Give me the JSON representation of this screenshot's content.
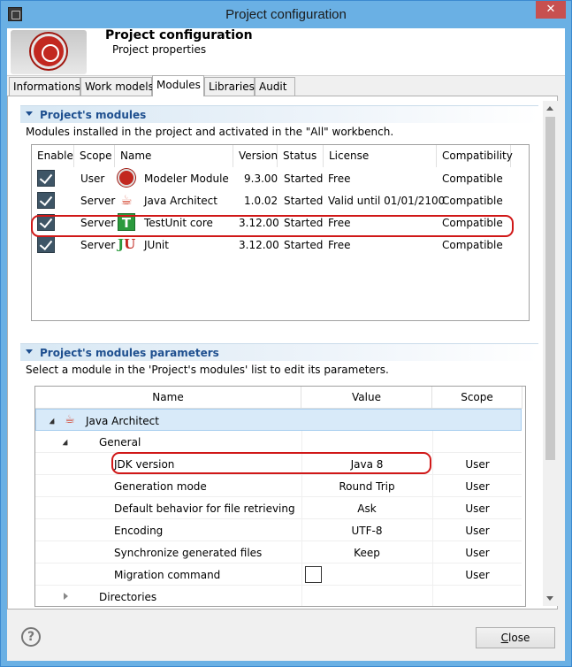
{
  "window": {
    "title": "Project configuration",
    "close_glyph": "✕"
  },
  "header": {
    "title": "Project configuration",
    "subtitle": "Project properties",
    "logo_icon": "modelio-logo-icon"
  },
  "tabs": [
    {
      "label": "Informations",
      "active": false
    },
    {
      "label": "Work models",
      "active": false
    },
    {
      "label": "Modules",
      "active": true
    },
    {
      "label": "Libraries",
      "active": false
    },
    {
      "label": "Audit",
      "active": false
    }
  ],
  "modules_section": {
    "title": "Project's modules",
    "description": "Modules installed in the project and activated in the \"All\" workbench.",
    "columns": [
      "Enable",
      "Scope",
      "Name",
      "Version",
      "Status",
      "License",
      "Compatibility"
    ],
    "rows": [
      {
        "enabled": true,
        "scope": "User",
        "icon": "modeler-module-icon",
        "name": "Modeler Module",
        "version": "9.3.00",
        "status": "Started",
        "license": "Free",
        "compatibility": "Compatible"
      },
      {
        "enabled": true,
        "scope": "Server",
        "icon": "java-icon",
        "name": "Java Architect",
        "version": "1.0.02",
        "status": "Started",
        "license": "Valid until 01/01/2100",
        "compatibility": "Compatible"
      },
      {
        "enabled": true,
        "scope": "Server",
        "icon": "testunit-icon",
        "name": "TestUnit core",
        "version": "3.12.00",
        "status": "Started",
        "license": "Free",
        "compatibility": "Compatible"
      },
      {
        "enabled": true,
        "scope": "Server",
        "icon": "junit-icon",
        "name": "JUnit",
        "version": "3.12.00",
        "status": "Started",
        "license": "Free",
        "compatibility": "Compatible"
      }
    ]
  },
  "params_section": {
    "title": "Project's modules parameters",
    "description": "Select a module in the 'Project's modules' list to edit its parameters.",
    "columns": [
      "Name",
      "Value",
      "Scope"
    ],
    "rows": [
      {
        "level": 0,
        "expander": "open",
        "name": "Java Architect",
        "value": "",
        "scope": "",
        "selected": true
      },
      {
        "level": 1,
        "expander": "open",
        "name": "General",
        "value": "",
        "scope": ""
      },
      {
        "level": 2,
        "name": "JDK version",
        "value": "Java 8",
        "scope": "User"
      },
      {
        "level": 2,
        "name": "Generation mode",
        "value": "Round Trip",
        "scope": "User"
      },
      {
        "level": 2,
        "name": "Default behavior for file retrieving",
        "value": "Ask",
        "scope": "User"
      },
      {
        "level": 2,
        "name": "Encoding",
        "value": "UTF-8",
        "scope": "User"
      },
      {
        "level": 2,
        "name": "Synchronize generated files",
        "value": "Keep",
        "scope": "User"
      },
      {
        "level": 2,
        "name": "Migration command",
        "value": "",
        "checkbox": true,
        "scope": "User"
      },
      {
        "level": 1,
        "expander": "closed",
        "name": "Directories",
        "value": "",
        "scope": ""
      }
    ]
  },
  "footer": {
    "help_glyph": "?",
    "close_label_first": "C",
    "close_label_rest": "lose"
  },
  "colors": {
    "highlight": "#d01818",
    "section_title": "#1e4f8f",
    "window_border": "#6ab0e4"
  }
}
